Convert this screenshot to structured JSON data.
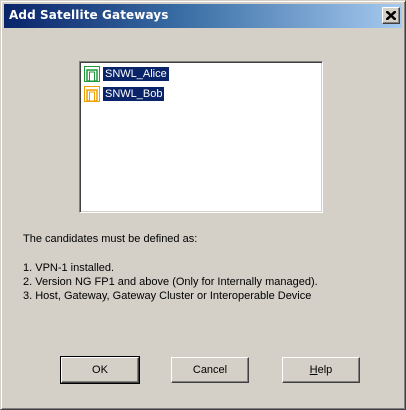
{
  "window": {
    "title": "Add Satellite Gateways"
  },
  "list": {
    "items": [
      {
        "label": "SNWL_Alice",
        "icon": "gateway-icon-green",
        "color": "#1f9a3a",
        "selected": true
      },
      {
        "label": "SNWL_Bob",
        "icon": "gateway-icon-orange",
        "color": "#f0a000",
        "selected": true
      }
    ]
  },
  "info": {
    "intro": "The candidates must be defined as:",
    "lines": [
      "1. VPN-1 installed.",
      "2. Version NG FP1 and above (Only for Internally managed).",
      "3. Host, Gateway, Gateway Cluster or Interoperable Device"
    ]
  },
  "buttons": {
    "ok": "OK",
    "cancel": "Cancel",
    "help": {
      "mnemonic": "H",
      "rest": "elp"
    }
  }
}
